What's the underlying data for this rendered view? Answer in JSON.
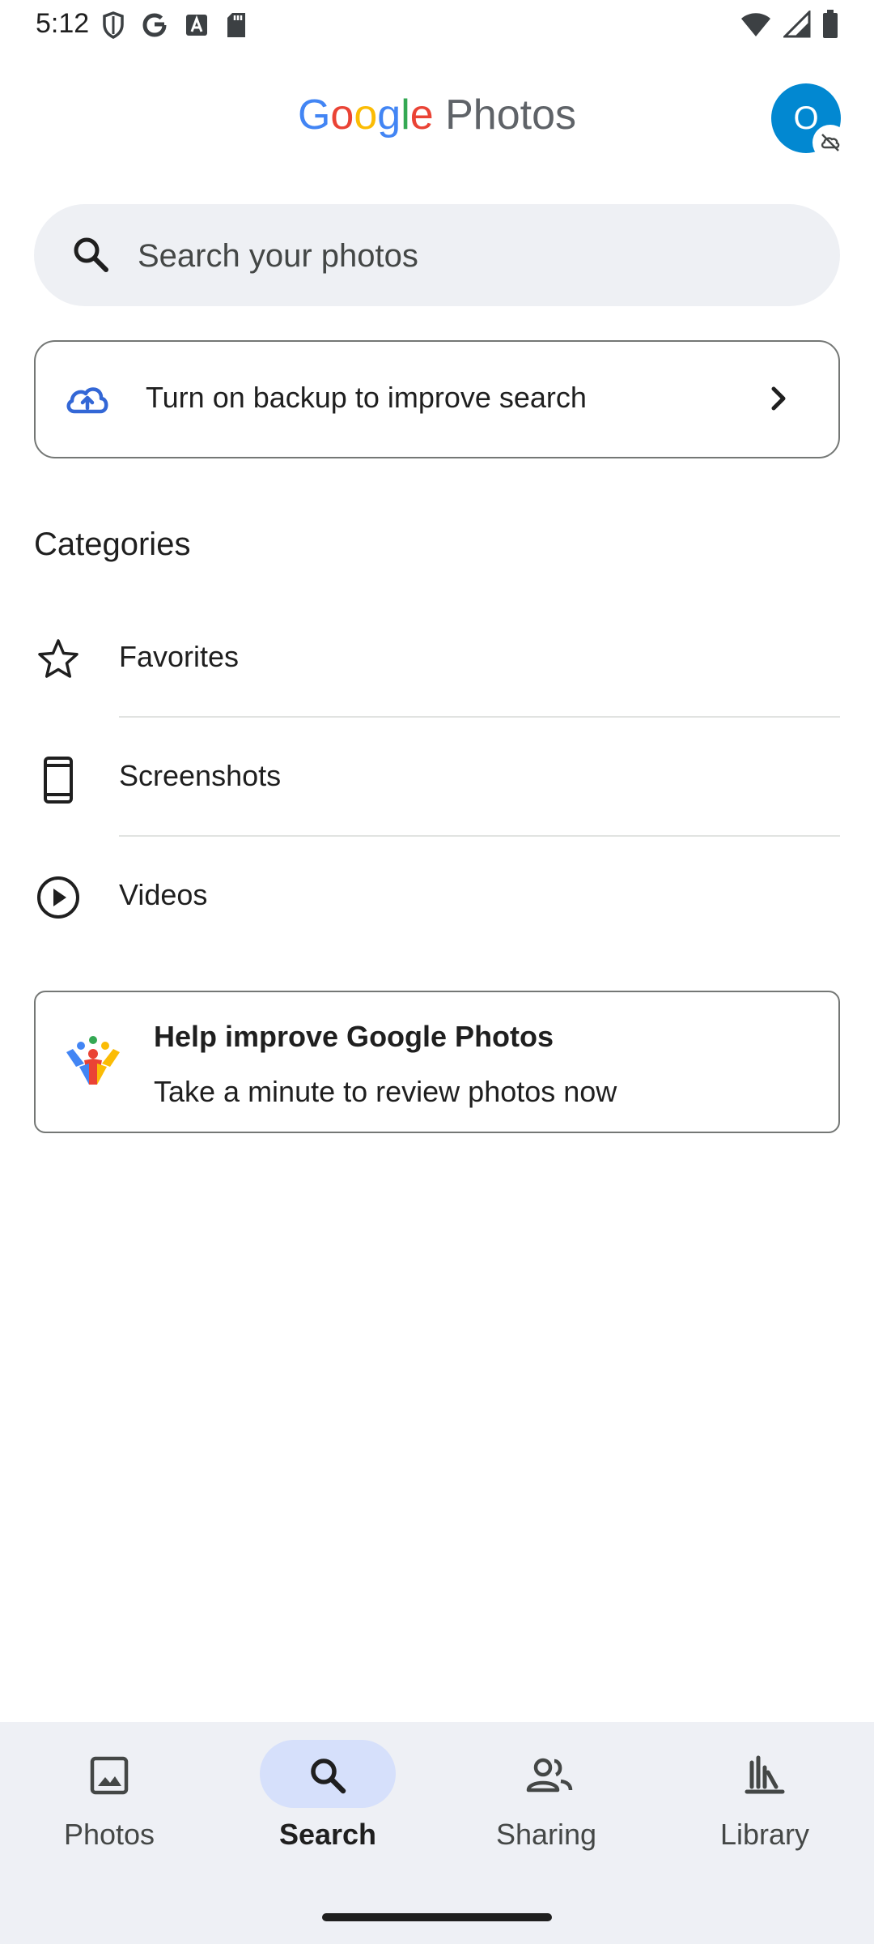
{
  "status_bar": {
    "time": "5:12",
    "left_icons": [
      "shield-icon",
      "google-g-icon",
      "a-badge-icon",
      "sd-card-icon"
    ],
    "right_icons": [
      "wifi-icon",
      "signal-icon",
      "battery-icon"
    ]
  },
  "header": {
    "title_google": [
      "G",
      "o",
      "o",
      "g",
      "l",
      "e"
    ],
    "title_rest": " Photos",
    "avatar_initial": "O",
    "avatar_color": "#0288d1"
  },
  "search": {
    "placeholder": "Search your photos",
    "value": ""
  },
  "backup_card": {
    "text": "Turn on backup to improve search"
  },
  "categories": {
    "heading": "Categories",
    "items": [
      {
        "label": "Favorites",
        "icon": "star-icon"
      },
      {
        "label": "Screenshots",
        "icon": "phone-icon"
      },
      {
        "label": "Videos",
        "icon": "play-circle-icon"
      }
    ]
  },
  "help_card": {
    "title": "Help improve Google Photos",
    "subtitle": "Take a minute to review photos now"
  },
  "bottom_nav": {
    "items": [
      {
        "label": "Photos",
        "icon": "photo-icon",
        "active": false
      },
      {
        "label": "Search",
        "icon": "search-icon",
        "active": true
      },
      {
        "label": "Sharing",
        "icon": "people-icon",
        "active": false
      },
      {
        "label": "Library",
        "icon": "library-icon",
        "active": false
      }
    ]
  },
  "colors": {
    "accent_pill": "#d6e0fb",
    "nav_background": "#eef0f5",
    "search_background": "#eef0f4"
  }
}
